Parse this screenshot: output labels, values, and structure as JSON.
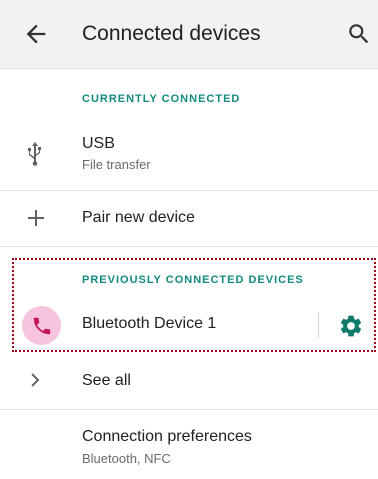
{
  "appbar": {
    "title": "Connected devices",
    "back_icon": "arrow-back-icon",
    "search_icon": "search-icon"
  },
  "currently_connected": {
    "header": "CURRENTLY CONNECTED",
    "items": [
      {
        "title": "USB",
        "subtitle": "File transfer",
        "icon": "usb-icon"
      }
    ]
  },
  "pair_new": {
    "label": "Pair new device",
    "icon": "plus-icon"
  },
  "previously_connected": {
    "header": "PREVIOUSLY CONNECTED DEVICES",
    "items": [
      {
        "title": "Bluetooth Device 1",
        "icon": "phone-icon",
        "settings_icon": "gear-icon"
      }
    ]
  },
  "see_all": {
    "label": "See all",
    "icon": "chevron-right-icon"
  },
  "connection_preferences": {
    "title": "Connection preferences",
    "subtitle": "Bluetooth, NFC"
  },
  "colors": {
    "accent": "#138a7e",
    "highlight_border": "#a3001a",
    "phone_circle": "#f6c4de",
    "phone_icon": "#c2185b"
  }
}
